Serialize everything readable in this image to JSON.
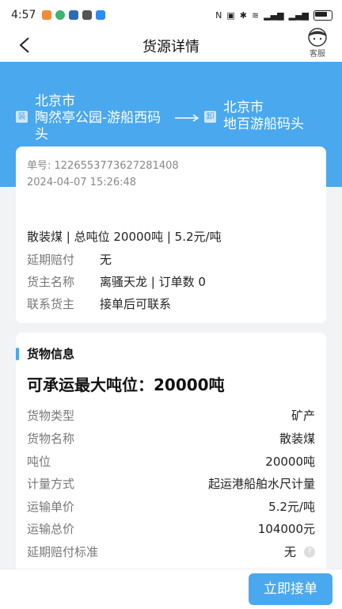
{
  "status_bar": {
    "time": "4:57"
  },
  "nav": {
    "title": "货源详情",
    "service_label": "客服"
  },
  "route": {
    "from_tag": "装",
    "from_city": "北京市",
    "from_place": "陶然亭公园-游船西码头",
    "to_tag": "卸",
    "to_city": "北京市",
    "to_place": "地百游船码头"
  },
  "order": {
    "order_no": "单号: 1226553773627281408",
    "datetime": "2024-04-07 15:26:48",
    "summary": "散装煤 | 总吨位 20000吨 | 5.2元/吨",
    "rows": [
      {
        "key": "延期赔付",
        "value": "无"
      },
      {
        "key": "货主名称",
        "value": "离骚天龙 | 订单数 0"
      },
      {
        "key": "联系货主",
        "value": "接单后可联系"
      }
    ]
  },
  "cargo": {
    "section_title": "货物信息",
    "capacity": "可承运最大吨位：20000吨",
    "rows": [
      {
        "key": "货物类型",
        "value": "矿产"
      },
      {
        "key": "货物名称",
        "value": "散装煤"
      },
      {
        "key": "吨位",
        "value": "20000吨"
      },
      {
        "key": "计量方式",
        "value": "起运港船舶水尺计量"
      },
      {
        "key": "运输单价",
        "value": "5.2元/吨"
      },
      {
        "key": "运输总价",
        "value": "104000元"
      },
      {
        "key": "延期赔付标准",
        "value": "无"
      }
    ]
  },
  "actions": {
    "accept": "立即接单"
  },
  "colors": {
    "accent": "#4aa8ee"
  }
}
